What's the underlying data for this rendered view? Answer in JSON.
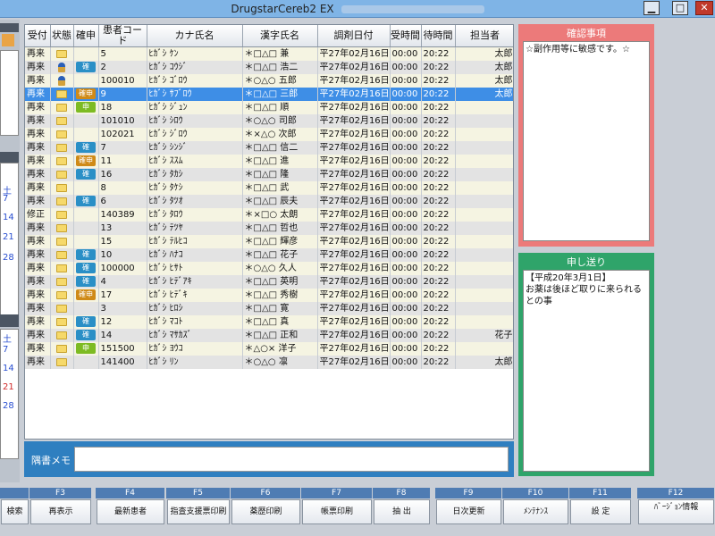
{
  "window": {
    "title": "DrugstarCereb2 EX"
  },
  "table": {
    "columns": [
      "受付",
      "状態",
      "確申",
      "患者コード",
      "カナ氏名",
      "漢字氏名",
      "調剤日付",
      "受時間",
      "待時間",
      "担当者"
    ],
    "rows": [
      {
        "uketsuke": "再来",
        "status": "folder",
        "badge": "",
        "code": "5",
        "kana": "ﾋｶﾞｼ ｹﾝ",
        "kanji": "＊□△□ 兼",
        "date": "平27年02月16日",
        "uke_time": "00:00",
        "wait": "20:22",
        "tanto": "太郎"
      },
      {
        "uketsuke": "再来",
        "status": "person",
        "badge": "確",
        "code": "2",
        "kana": "ﾋｶﾞｼ ｺｳｼﾞ",
        "kanji": "＊□△□ 浩二",
        "date": "平27年02月16日",
        "uke_time": "00:00",
        "wait": "20:22",
        "tanto": "太郎"
      },
      {
        "uketsuke": "再来",
        "status": "person",
        "badge": "",
        "code": "100010",
        "kana": "ﾋｶﾞｼ ｺﾞﾛｳ",
        "kanji": "＊○△○ 五郎",
        "date": "平27年02月16日",
        "uke_time": "00:00",
        "wait": "20:22",
        "tanto": "太郎"
      },
      {
        "uketsuke": "再来",
        "status": "folder",
        "badge": "確申",
        "code": "9",
        "kana": "ﾋｶﾞｼ ｻﾌﾞﾛｳ",
        "kanji": "＊□△□ 三郎",
        "date": "平27年02月16日",
        "uke_time": "00:00",
        "wait": "20:22",
        "tanto": "太郎"
      },
      {
        "uketsuke": "再来",
        "status": "folder",
        "badge": "申",
        "code": "18",
        "kana": "ﾋｶﾞｼ ｼﾞｭﾝ",
        "kanji": "＊□△□ 順",
        "date": "平27年02月16日",
        "uke_time": "00:00",
        "wait": "20:22",
        "tanto": ""
      },
      {
        "uketsuke": "再来",
        "status": "folder",
        "badge": "",
        "code": "101010",
        "kana": "ﾋｶﾞｼ ｼﾛｳ",
        "kanji": "＊○△○ 司郎",
        "date": "平27年02月16日",
        "uke_time": "00:00",
        "wait": "20:22",
        "tanto": ""
      },
      {
        "uketsuke": "再来",
        "status": "folder",
        "badge": "",
        "code": "102021",
        "kana": "ﾋｶﾞｼ ｼﾞﾛｳ",
        "kanji": "＊×△○ 次郎",
        "date": "平27年02月16日",
        "uke_time": "00:00",
        "wait": "20:22",
        "tanto": ""
      },
      {
        "uketsuke": "再来",
        "status": "folder",
        "badge": "確",
        "code": "7",
        "kana": "ﾋｶﾞｼ ｼﾝｼﾞ",
        "kanji": "＊□△□ 信二",
        "date": "平27年02月16日",
        "uke_time": "00:00",
        "wait": "20:22",
        "tanto": ""
      },
      {
        "uketsuke": "再来",
        "status": "folder",
        "badge": "確申",
        "code": "11",
        "kana": "ﾋｶﾞｼ ｽｽﾑ",
        "kanji": "＊□△□ 進",
        "date": "平27年02月16日",
        "uke_time": "00:00",
        "wait": "20:22",
        "tanto": ""
      },
      {
        "uketsuke": "再来",
        "status": "folder",
        "badge": "確",
        "code": "16",
        "kana": "ﾋｶﾞｼ ﾀｶｼ",
        "kanji": "＊□△□ 隆",
        "date": "平27年02月16日",
        "uke_time": "00:00",
        "wait": "20:22",
        "tanto": ""
      },
      {
        "uketsuke": "再来",
        "status": "folder",
        "badge": "",
        "code": "8",
        "kana": "ﾋｶﾞｼ ﾀｹｼ",
        "kanji": "＊□△□ 武",
        "date": "平27年02月16日",
        "uke_time": "00:00",
        "wait": "20:22",
        "tanto": ""
      },
      {
        "uketsuke": "再来",
        "status": "folder",
        "badge": "確",
        "code": "6",
        "kana": "ﾋｶﾞｼ ﾀﾂｵ",
        "kanji": "＊□△□ 辰夫",
        "date": "平27年02月16日",
        "uke_time": "00:00",
        "wait": "20:22",
        "tanto": ""
      },
      {
        "uketsuke": "修正",
        "status": "folder",
        "badge": "",
        "code": "140389",
        "kana": "ﾋｶﾞｼ ﾀﾛｳ",
        "kanji": "＊×□○ 太朗",
        "date": "平27年02月16日",
        "uke_time": "00:00",
        "wait": "20:22",
        "tanto": ""
      },
      {
        "uketsuke": "再来",
        "status": "folder",
        "badge": "",
        "code": "13",
        "kana": "ﾋｶﾞｼ ﾃﾂﾔ",
        "kanji": "＊□△□ 哲也",
        "date": "平27年02月16日",
        "uke_time": "00:00",
        "wait": "20:22",
        "tanto": ""
      },
      {
        "uketsuke": "再来",
        "status": "folder",
        "badge": "",
        "code": "15",
        "kana": "ﾋｶﾞｼ ﾃﾙﾋｺ",
        "kanji": "＊□△□ 輝彦",
        "date": "平27年02月16日",
        "uke_time": "00:00",
        "wait": "20:22",
        "tanto": ""
      },
      {
        "uketsuke": "再来",
        "status": "folder",
        "badge": "確",
        "code": "10",
        "kana": "ﾋｶﾞｼ ﾊﾅｺ",
        "kanji": "＊□△□ 花子",
        "date": "平27年02月16日",
        "uke_time": "00:00",
        "wait": "20:22",
        "tanto": ""
      },
      {
        "uketsuke": "再来",
        "status": "folder",
        "badge": "確",
        "code": "100000",
        "kana": "ﾋｶﾞｼ ﾋｻﾄ",
        "kanji": "＊○△○ 久人",
        "date": "平27年02月16日",
        "uke_time": "00:00",
        "wait": "20:22",
        "tanto": ""
      },
      {
        "uketsuke": "再来",
        "status": "folder",
        "badge": "確",
        "code": "4",
        "kana": "ﾋｶﾞｼ ﾋﾃﾞｱｷ",
        "kanji": "＊□△□ 英明",
        "date": "平27年02月16日",
        "uke_time": "00:00",
        "wait": "20:22",
        "tanto": ""
      },
      {
        "uketsuke": "再来",
        "status": "folder",
        "badge": "確申",
        "code": "17",
        "kana": "ﾋｶﾞｼ ﾋﾃﾞｷ",
        "kanji": "＊□△□ 秀樹",
        "date": "平27年02月16日",
        "uke_time": "00:00",
        "wait": "20:22",
        "tanto": ""
      },
      {
        "uketsuke": "再来",
        "status": "folder",
        "badge": "",
        "code": "3",
        "kana": "ﾋｶﾞｼ ﾋﾛｼ",
        "kanji": "＊□△□ 寛",
        "date": "平27年02月16日",
        "uke_time": "00:00",
        "wait": "20:22",
        "tanto": ""
      },
      {
        "uketsuke": "再来",
        "status": "folder",
        "badge": "確",
        "code": "12",
        "kana": "ﾋｶﾞｼ ﾏｺﾄ",
        "kanji": "＊□△□ 真",
        "date": "平27年02月16日",
        "uke_time": "00:00",
        "wait": "20:22",
        "tanto": ""
      },
      {
        "uketsuke": "再来",
        "status": "folder",
        "badge": "確",
        "code": "14",
        "kana": "ﾋｶﾞｼ ﾏｻｶｽﾞ",
        "kanji": "＊□△□ 正和",
        "date": "平27年02月16日",
        "uke_time": "00:00",
        "wait": "20:22",
        "tanto": "花子"
      },
      {
        "uketsuke": "再来",
        "status": "folder",
        "badge": "申",
        "code": "151500",
        "kana": "ﾋｶﾞｼ ﾖｳｺ",
        "kanji": "＊△○× 洋子",
        "date": "平27年02月16日",
        "uke_time": "00:00",
        "wait": "20:22",
        "tanto": ""
      },
      {
        "uketsuke": "再来",
        "status": "folder",
        "badge": "",
        "code": "141400",
        "kana": "ﾋｶﾞｼ ﾘﾝ",
        "kanji": "＊○△○ 凛",
        "date": "平27年02月16日",
        "uke_time": "00:00",
        "wait": "20:22",
        "tanto": "太郎"
      }
    ],
    "selected_row": 3
  },
  "memo": {
    "label": "隅書メモ",
    "value": ""
  },
  "confirm_panel": {
    "title": "確認事項",
    "text": "☆副作用等に敏感です。☆"
  },
  "handover_panel": {
    "title": "申し送り",
    "text": "【平成20年3月1日】\nお薬は後ほど取りに来られるとの事"
  },
  "left_calendar": {
    "sat_label": "土",
    "days_top": [
      "7",
      "14",
      "21",
      "28"
    ],
    "days_bottom": [
      "土",
      "7",
      "14",
      "21",
      "28"
    ]
  },
  "function_keys": [
    {
      "key": "",
      "label": "検索"
    },
    {
      "key": "F3",
      "label": "再表示"
    },
    {
      "key": "F4",
      "label": "最新患者"
    },
    {
      "key": "F5",
      "label": "指査支援票印刷"
    },
    {
      "key": "F6",
      "label": "薬歴印刷"
    },
    {
      "key": "F7",
      "label": "帳票印刷"
    },
    {
      "key": "F8",
      "label": "抽 出"
    },
    {
      "key": "F9",
      "label": "日次更新"
    },
    {
      "key": "F10",
      "label": "ﾒﾝﾃﾅﾝｽ"
    },
    {
      "key": "F11",
      "label": "設 定"
    },
    {
      "key": "F12",
      "label": "ﾊﾞｰｼﾞｮﾝ情報"
    }
  ],
  "colors": {
    "selected": "#3e8ee6",
    "confirm": "#ec7a7a",
    "handover": "#2fa46a",
    "fkey": "#4f7cb3"
  }
}
